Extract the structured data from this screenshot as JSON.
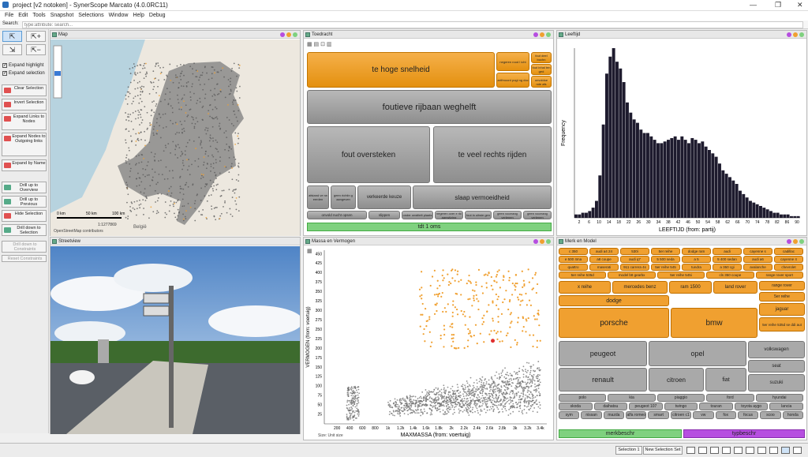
{
  "window": {
    "title": "project [v2 notoken] - SynerScope Marcato (4.0.0RC11)",
    "min": "—",
    "max": "❐",
    "close": "✕"
  },
  "menu": [
    "File",
    "Edit",
    "Tools",
    "Snapshot",
    "Selections",
    "Window",
    "Help",
    "Debug"
  ],
  "search": {
    "label": "Search:",
    "placeholder": "type:attribute: search..."
  },
  "left": {
    "checks": [
      {
        "label": "Expand highlight",
        "checked": true
      },
      {
        "label": "Expand selection",
        "checked": true
      }
    ],
    "actions": [
      "Clear Selection",
      "Invert Selection",
      "Expand Links to Nodes",
      "Expand Nodes to Outgoing links",
      "Expand by Name",
      "Drill up to Overview",
      "Drill up to Previous",
      "Hide Selection",
      "Drill down to Selection"
    ],
    "disabled": [
      "Drill down to Constraints",
      "Reset Constraints"
    ]
  },
  "map": {
    "title": "Map",
    "scale": "1:1277869",
    "scale_labels": [
      "0 km",
      "50 km",
      "100 km"
    ],
    "credit": "OpenStreetMap contributors",
    "country": "België"
  },
  "streetview": {
    "title": "Streetview"
  },
  "toedracht": {
    "title": "Toedracht",
    "tiles": [
      {
        "label": "te hoge snelheid",
        "o": true
      },
      {
        "label": "negeren rood l icht",
        "o": true
      },
      {
        "label": "fout deel bochn",
        "o": true
      },
      {
        "label": "fout inhal ten ged",
        "o": true
      },
      {
        "label": "zelfmoord pogi ng doc",
        "o": true
      },
      {
        "label": "onvoldoe nde afs",
        "o": true
      },
      {
        "label": "foutieve rijbaan weghelft"
      },
      {
        "label": "fout oversteken"
      },
      {
        "label": "te veel rechts rijden"
      },
      {
        "label": "afstand ve rw eerden"
      },
      {
        "label": "geen richtin g aangeven"
      },
      {
        "label": "verkeerde keuze"
      },
      {
        "label": "slaap vermoeidheid"
      },
      {
        "label": "onvold nucht opsen"
      },
      {
        "label": "slippen"
      },
      {
        "label": "onder onstitelt plaats"
      },
      {
        "label": "negeren over e rkl aanwijzing"
      },
      {
        "label": "fout in uitwie gen"
      },
      {
        "label": "geen voorrang verlenen"
      },
      {
        "label": "geen voorrang verlenen"
      }
    ],
    "footer": "tdt 1 oms"
  },
  "leeftijd": {
    "title": "Leeftijd"
  },
  "massa": {
    "title": "Massa en Vermogen",
    "footer": "Size: Unit size"
  },
  "merk": {
    "title": "Merk en Model",
    "small": [
      "c 350",
      "audi a4 24",
      "530i",
      "5er reihe",
      "dodge ram",
      "audi",
      "cayenne s",
      "cadillac",
      "e 500 4ma",
      "a8 coupe",
      "audi q7",
      "5 500 seda",
      "a 5",
      "5 400 sedan",
      "audi a6",
      "cayenne 4",
      "quattro",
      "maserati",
      "911 carrera 4s",
      "5er reihe 545",
      "tundra",
      "a 350 cgi",
      "avalanche",
      "chevrolet",
      "5er reihe 535d",
      "model b8 gearbx",
      "5er reihe 545i",
      "cls 350 coupe",
      "range rover sport"
    ],
    "mid": [
      "x reihe",
      "mercedes benz",
      "ram 1500",
      "land rover",
      "range rover",
      "5er reihe",
      "dodge",
      "jaguar",
      "5er reihe 535d se ddi aut"
    ],
    "big": [
      "porsche",
      "bmw",
      "peugeot",
      "opel",
      "volkswagen",
      "seat",
      "renault",
      "citroen",
      "fiat",
      "suzuki"
    ],
    "tiny": [
      "polo",
      "kia",
      "piaggio",
      "ford",
      "hyundai",
      "skoda",
      "daihatsu",
      "peugeot 107",
      "twingo",
      "touran",
      "toyota aygo",
      "lancia",
      "sym",
      "nissan",
      "mazda",
      "alfa romeo",
      "smart",
      "citroen c1",
      "vw",
      "fox",
      "focus",
      "scoo",
      "honda"
    ],
    "tabs": [
      "merkbeschr",
      "typbeschr"
    ]
  },
  "status": {
    "selection": "Selection 1",
    "new_set": "New Selection Set"
  },
  "colors": {
    "orange": "#f0a030",
    "gray": "#8e8e8e",
    "green": "#7fd17f",
    "purple": "#b64ee0",
    "histogram": "#1e1b2e"
  },
  "chart_data": [
    {
      "type": "bar",
      "title": "Leeftijd",
      "xlabel": "LEEFTIJD (from: partij)",
      "ylabel": "Frequency",
      "x_ticks": [
        "2",
        "6",
        "10",
        "14",
        "18",
        "22",
        "26",
        "30",
        "34",
        "38",
        "42",
        "46",
        "50",
        "54",
        "58",
        "62",
        "66",
        "70",
        "74",
        "78",
        "82",
        "86",
        "90"
      ],
      "values": [
        2,
        2,
        3,
        3,
        4,
        6,
        10,
        25,
        55,
        85,
        95,
        100,
        92,
        88,
        80,
        68,
        62,
        58,
        56,
        52,
        50,
        50,
        48,
        46,
        44,
        44,
        45,
        46,
        47,
        48,
        46,
        48,
        46,
        44,
        47,
        46,
        44,
        45,
        42,
        40,
        38,
        36,
        32,
        28,
        26,
        24,
        22,
        20,
        16,
        14,
        12,
        10,
        9,
        8,
        7,
        6,
        5,
        4,
        3,
        3,
        2,
        2,
        2,
        1,
        1,
        1
      ]
    },
    {
      "type": "scatter",
      "title": "Massa en Vermogen",
      "xlabel": "MAXMASSA (from: voertuig)",
      "ylabel": "VERMOGEN (from: voertuig)",
      "x_ticks": [
        "200",
        "400",
        "600",
        "800",
        "1k",
        "1.2k",
        "1.4k",
        "1.6k",
        "1.8k",
        "2k",
        "2.2k",
        "2.4k",
        "2.6k",
        "2.8k",
        "3k",
        "3.2k",
        "3.4k"
      ],
      "y_ticks": [
        "25",
        "50",
        "75",
        "100",
        "125",
        "150",
        "175",
        "200",
        "225",
        "250",
        "275",
        "300",
        "325",
        "350",
        "375",
        "400",
        "425",
        "450"
      ],
      "xlim": [
        0,
        3500
      ],
      "ylim": [
        0,
        460
      ],
      "series": [
        {
          "values": []
        },
        {
          "values": []
        }
      ]
    }
  ]
}
